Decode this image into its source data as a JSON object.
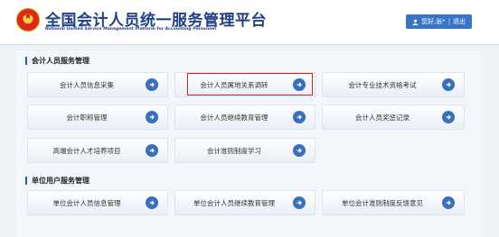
{
  "header": {
    "title": "全国会计人员统一服务管理平台",
    "subtitle": "National Unified Service Management Platform for Accounting Personnel",
    "greeting": "您好,张*",
    "separator": "|",
    "logout": "退出"
  },
  "sections": [
    {
      "title": "会计人员服务管理",
      "tiles": [
        {
          "label": "会计人员信息采集",
          "icon": "arrow-right-icon"
        },
        {
          "label": "会计人员属地关系调转",
          "icon": "arrow-right-icon",
          "highlighted": true
        },
        {
          "label": "会计专业技术资格考试",
          "icon": "arrow-right-icon"
        },
        {
          "label": "会计职称管理",
          "icon": "arrow-right-icon"
        },
        {
          "label": "会计人员继续教育管理",
          "icon": "arrow-right-icon"
        },
        {
          "label": "会计人员奖惩记录",
          "icon": "arrow-right-icon"
        },
        {
          "label": "高端会计人才培养项目",
          "icon": "arrow-right-icon"
        },
        {
          "label": "会计准则制度学习",
          "icon": "arrow-right-icon"
        }
      ]
    },
    {
      "title": "单位用户服务管理",
      "tiles": [
        {
          "label": "单位会计人员信息管理",
          "icon": "arrow-right-icon"
        },
        {
          "label": "单位会计人员继续教育管理",
          "icon": "arrow-right-icon"
        },
        {
          "label": "单位会计准则制度反馈意见",
          "icon": "arrow-right-icon"
        }
      ]
    }
  ],
  "colors": {
    "brand": "#1f3f86",
    "accent": "#3a6fc0",
    "highlight": "#e02020"
  }
}
